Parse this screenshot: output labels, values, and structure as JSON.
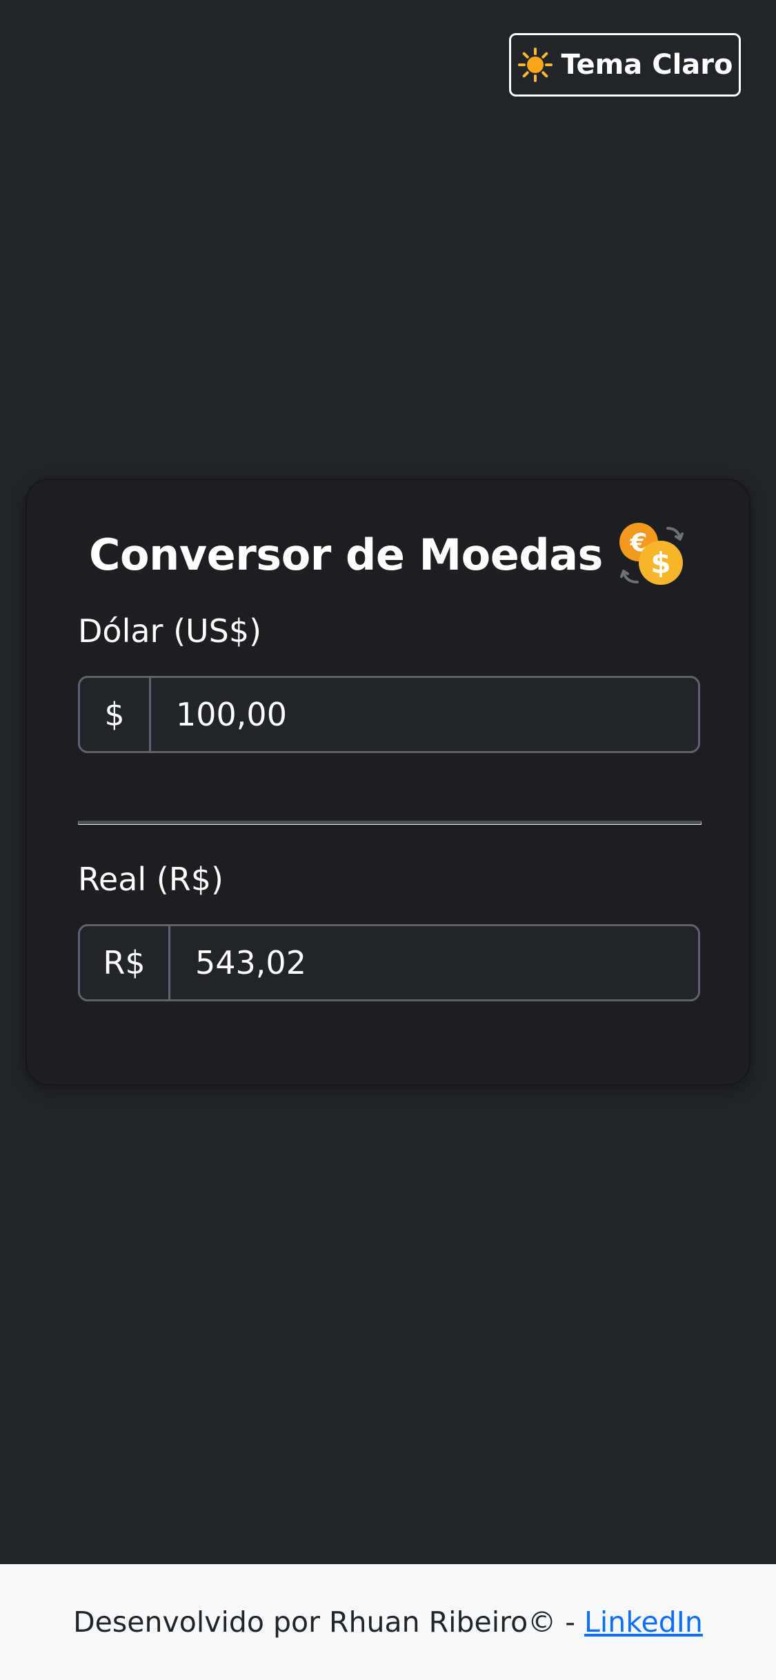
{
  "header": {
    "theme_toggle_label": "Tema Claro",
    "theme_toggle_icon": "sun-icon"
  },
  "converter": {
    "title": "Conversor de Moedas",
    "title_icon": "currency-exchange-coins-icon",
    "dollar": {
      "label": "Dólar (US$)",
      "prefix": "$",
      "value": "100,00"
    },
    "real": {
      "label": "Real (R$)",
      "prefix": "R$",
      "value": "543,02"
    }
  },
  "footer": {
    "text": "Desenvolvido por Rhuan Ribeiro© - ",
    "link_label": "LinkedIn"
  },
  "colors": {
    "background": "#212429",
    "card": "#1c1e21",
    "footer_bg": "#f8f9fa",
    "link": "#0d6efd",
    "coin_gold": "#f6b52b"
  }
}
